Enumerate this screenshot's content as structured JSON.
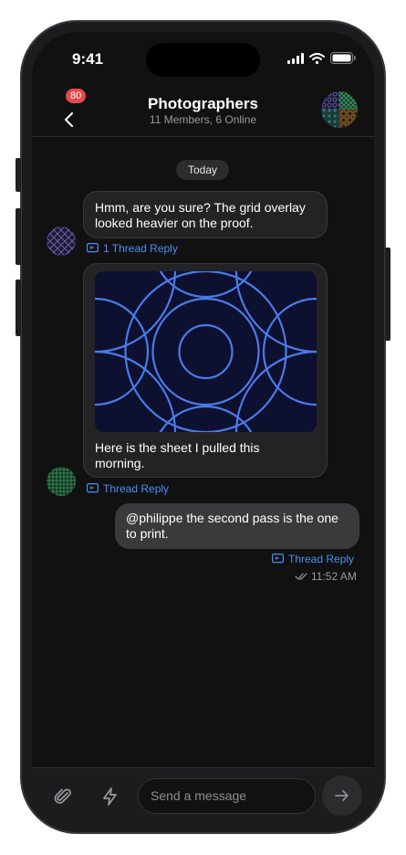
{
  "status": {
    "time": "9:41"
  },
  "header": {
    "title": "Photographers",
    "subtitle": "11 Members, 6 Online",
    "back_badge": "80"
  },
  "messages": {
    "date_separator": "Today",
    "m1": {
      "text": "Hmm, are you sure? The grid overlay looked heavier on the proof.",
      "thread": "1 Thread Reply"
    },
    "m2": {
      "caption": "Here is the sheet I pulled this morning.",
      "thread": "Thread Reply"
    },
    "m3": {
      "text": "@philippe the second pass is the one to print.",
      "thread": "Thread Reply",
      "time": "11:52 AM"
    }
  },
  "composer": {
    "placeholder": "Send a message"
  },
  "colors": {
    "accent": "#4b8ef7",
    "badge": "#e5484d",
    "background": "#111111"
  }
}
